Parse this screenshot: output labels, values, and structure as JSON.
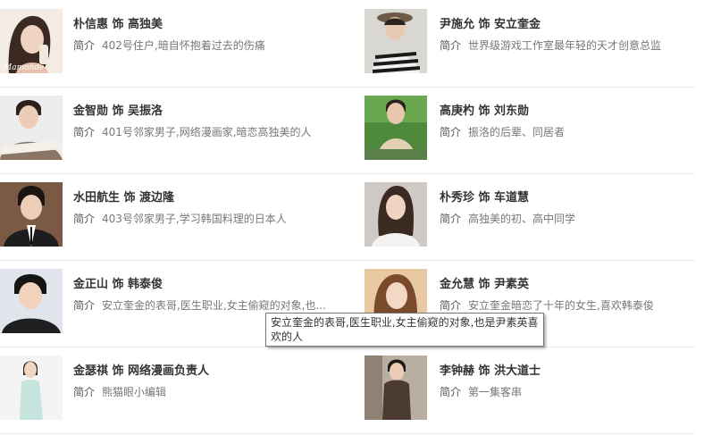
{
  "desc_prefix": "简介",
  "cast": [
    {
      "name": "朴信惠 饰 高独美",
      "desc": "402号住户,暗自怀抱着过去的伤痛",
      "photo_caption": "Mamonde"
    },
    {
      "name": "尹施允 饰 安立奎金",
      "desc": "世界级游戏工作室最年轻的天才创意总监"
    },
    {
      "name": "金智勋 饰 吴振洛",
      "desc": "401号邻家男子,网络漫画家,暗恋高独美的人"
    },
    {
      "name": "高庚杓 饰 刘东勋",
      "desc": "振洛的后辈、同居者"
    },
    {
      "name": "水田航生 饰 渡边隆",
      "desc": "403号邻家男子,学习韩国料理的日本人"
    },
    {
      "name": "朴秀珍 饰 车道慧",
      "desc": "高独美的初、高中同学"
    },
    {
      "name": "金正山 饰 韩泰俊",
      "desc": "安立奎金的表哥,医生职业,女主偷窥的对象,也..."
    },
    {
      "name": "金允慧 饰 尹素英",
      "desc": "安立奎金暗恋了十年的女生,喜欢韩泰俊"
    },
    {
      "name": "金瑟祺 饰 网络漫画负责人",
      "desc": "熊猫眼小编辑"
    },
    {
      "name": "李钟赫 饰 洪大道士",
      "desc": "第一集客串"
    }
  ],
  "tooltip": "安立奎金的表哥,医生职业,女主偷窥的对象,也是尹素英喜欢的人"
}
